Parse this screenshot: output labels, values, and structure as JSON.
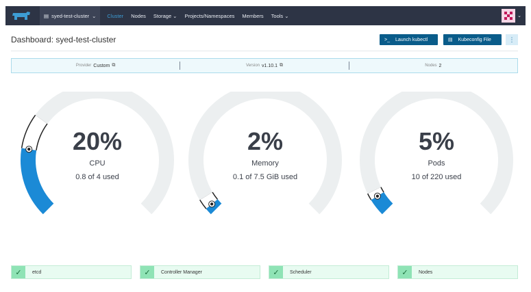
{
  "nav": {
    "cluster_name": "syed-test-cluster",
    "items": [
      {
        "label": "Cluster",
        "active": true,
        "dropdown": false
      },
      {
        "label": "Nodes",
        "active": false,
        "dropdown": false
      },
      {
        "label": "Storage",
        "active": false,
        "dropdown": true
      },
      {
        "label": "Projects/Namespaces",
        "active": false,
        "dropdown": false
      },
      {
        "label": "Members",
        "active": false,
        "dropdown": false
      },
      {
        "label": "Tools",
        "active": false,
        "dropdown": true
      }
    ]
  },
  "header": {
    "title": "Dashboard: syed-test-cluster",
    "kubectl_label": "Launch kubectl",
    "kubeconfig_label": "Kubeconfig File",
    "more_label": "⋮"
  },
  "info": {
    "provider_label": "Provider",
    "provider_value": "Custom",
    "version_label": "Version",
    "version_value": "v1.10.1",
    "nodes_label": "Nodes",
    "nodes_value": "2"
  },
  "gauges": [
    {
      "percent_text": "20%",
      "name": "CPU",
      "detail": "0.8 of 4 used",
      "percent": 0.2,
      "reserved": 0.1
    },
    {
      "percent_text": "2%",
      "name": "Memory",
      "detail": "0.1 of 7.5 GiB used",
      "percent": 0.02,
      "reserved": 0.03
    },
    {
      "percent_text": "5%",
      "name": "Pods",
      "detail": "10 of 220 used",
      "percent": 0.05,
      "reserved": 0.02
    }
  ],
  "components": [
    {
      "label": "etcd"
    },
    {
      "label": "Controller Manager"
    },
    {
      "label": "Scheduler"
    },
    {
      "label": "Nodes"
    }
  ],
  "colors": {
    "nav_bg": "#2d3445",
    "accent": "#0a5c8a",
    "gauge_fill": "#1b8ad6",
    "gauge_track": "#eceff0",
    "ok": "#8fe3b5"
  }
}
